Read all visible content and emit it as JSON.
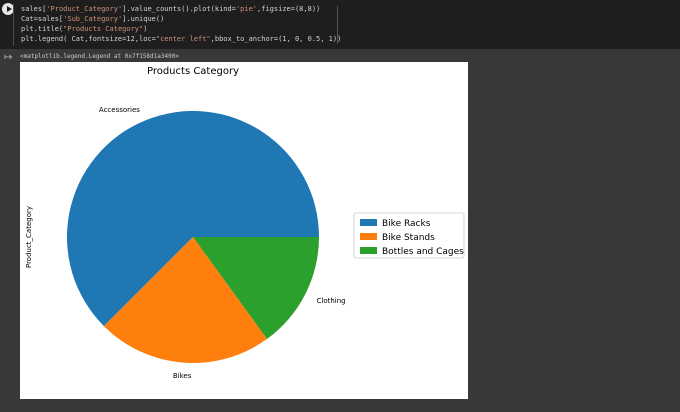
{
  "cell": {
    "code": [
      [
        {
          "t": "sales[",
          "c": "plain"
        },
        {
          "t": "'Product_Category'",
          "c": "str"
        },
        {
          "t": "].value_counts().plot(kind=",
          "c": "plain"
        },
        {
          "t": "'pie'",
          "c": "str"
        },
        {
          "t": ",figsize=(8,8))",
          "c": "plain"
        }
      ],
      [
        {
          "t": "Cat=sales[",
          "c": "plain"
        },
        {
          "t": "'Sub_Category'",
          "c": "str"
        },
        {
          "t": "].unique()",
          "c": "plain"
        }
      ],
      [
        {
          "t": "plt.title(",
          "c": "plain"
        },
        {
          "t": "\"Products Category\"",
          "c": "str"
        },
        {
          "t": ")",
          "c": "plain"
        }
      ],
      [
        {
          "t": "plt.legend( Cat,fontsize=12,loc=",
          "c": "plain"
        },
        {
          "t": "\"center left\"",
          "c": "str"
        },
        {
          "t": ",bbox_to_anchor=(1, 0, 0.5, 1))",
          "c": "plain"
        }
      ]
    ],
    "output_text": "<matplotlib.legend.Legend at 0x7f158d1a3400>"
  },
  "chart_data": {
    "type": "pie",
    "title": "Products Category",
    "ylabel": "Product_Category",
    "categories": [
      "Accessories",
      "Bikes",
      "Clothing"
    ],
    "values": [
      62.5,
      22.5,
      15.0
    ],
    "colors": [
      "#1f77b4",
      "#ff7f0e",
      "#2ca02c"
    ],
    "legend": {
      "placement": "center-left-outside",
      "entries": [
        "Bike Racks",
        "Bike Stands",
        "Bottles and Cages"
      ]
    }
  }
}
